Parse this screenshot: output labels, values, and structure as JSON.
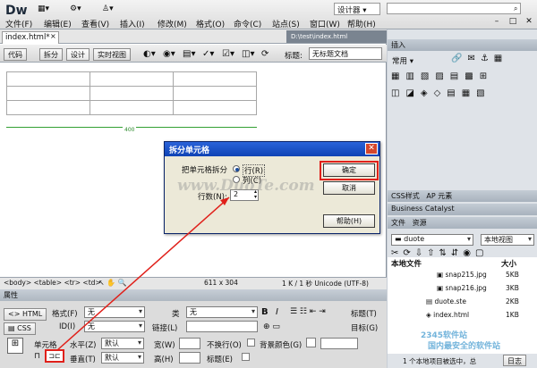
{
  "app": {
    "logo": "Dw",
    "workspace": "设计器"
  },
  "menu": [
    "文件(F)",
    "编辑(E)",
    "查看(V)",
    "插入(I)",
    "修改(M)",
    "格式(O)",
    "命令(C)",
    "站点(S)",
    "窗口(W)",
    "帮助(H)"
  ],
  "document": {
    "tab": "index.html*",
    "path": "D:\\test\\index.html"
  },
  "viewbar": {
    "code": "代码",
    "split": "拆分",
    "design": "设计",
    "live": "实时视图",
    "title_label": "标题:",
    "title_value": "无标题文档"
  },
  "ruler_label": "400",
  "statusbar": {
    "tags": "<body> <table> <tr> <td>",
    "size": "611 x 304",
    "info": "1 K / 1 秒  Unicode (UTF-8)"
  },
  "properties": {
    "header": "属性",
    "html_btn": "HTML",
    "css_btn": "CSS",
    "format_label": "格式(F)",
    "format_value": "无",
    "id_label": "ID(I)",
    "id_value": "无",
    "class_label": "类",
    "class_value": "无",
    "link_label": "链接(L)",
    "bold": "B",
    "italic": "I",
    "title_label": "标题(T)",
    "target_label": "目标(G)",
    "cell_label": "单元格",
    "merge_icon": "⊓",
    "split_label": "⊐⊏",
    "horz_label": "水平(Z)",
    "horz_value": "默认",
    "vert_label": "垂直(T)",
    "vert_value": "默认",
    "width_label": "宽(W)",
    "height_label": "高(H)",
    "nowrap_label": "不换行(O)",
    "header_label": "标题(E)",
    "bg_label": "背景颜色(G)"
  },
  "panel": {
    "insert_header": "插入",
    "insert_mode": "常用",
    "css_header": "CSS样式",
    "ap_header": "AP 元素",
    "bc_header": "Business Catalyst",
    "files_tab": "文件",
    "assets_tab": "资源",
    "site_name": "duote",
    "view_mode": "本地视图",
    "col_local": "本地文件",
    "col_size": "大小",
    "files": [
      {
        "name": "snap215.jpg",
        "size": "5KB"
      },
      {
        "name": "snap216.jpg",
        "size": "3KB"
      },
      {
        "name": "duote.ste",
        "size": "2KB"
      },
      {
        "name": "index.html",
        "size": "1KB"
      }
    ],
    "footer_status": "1 个本地项目被选中，总",
    "footer_btn": "日志"
  },
  "dialog": {
    "title": "拆分单元格",
    "split_label": "把单元格拆分",
    "opt_rows": "行(R)",
    "opt_cols": "列(C)",
    "rows_count_label": "行数(N):",
    "rows_count_value": "2",
    "ok": "确定",
    "cancel": "取消",
    "help": "帮助(H)"
  },
  "watermark": "www.DuoTe.com",
  "bottom_watermark1": "2345软件站",
  "bottom_watermark2": "国内最安全的软件站",
  "colors": {
    "accent": "#0f43b5",
    "highlight": "#e0201a",
    "ruler": "#33a033"
  }
}
